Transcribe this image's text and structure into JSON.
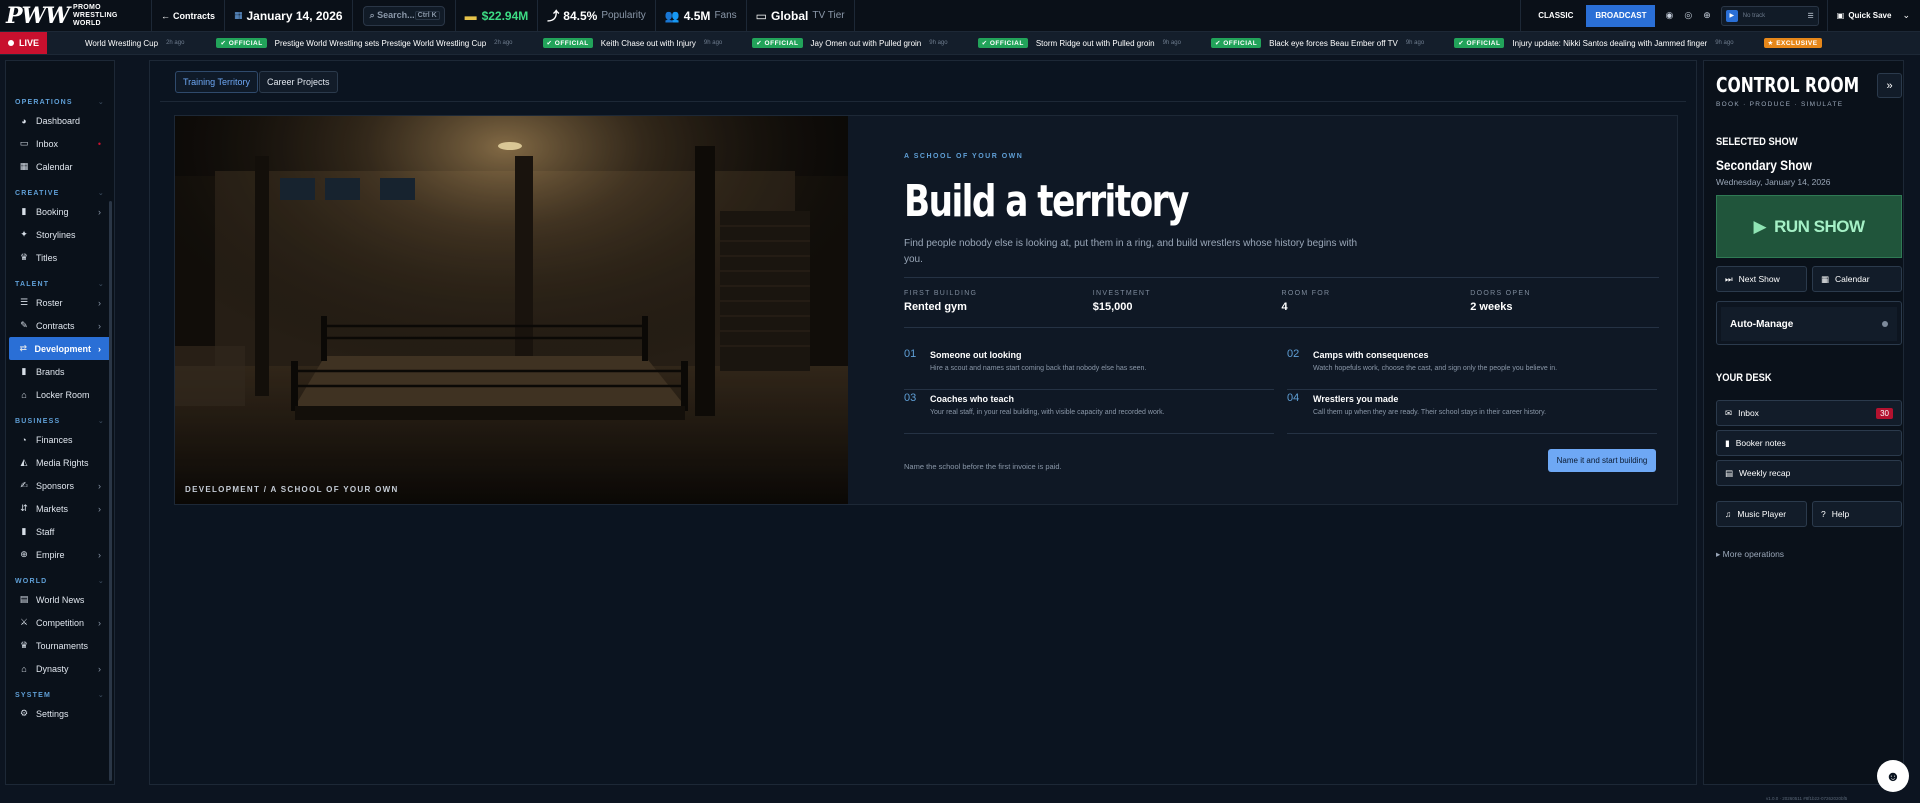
{
  "topbar": {
    "logo_main": "PWW",
    "logo_sub": "PROMO WRESTLING WORLD",
    "contracts": "Contracts",
    "date": "January 14, 2026",
    "search_placeholder": "Search...",
    "search_shortcut": "Ctrl K",
    "money": "$22.94M",
    "popularity": "84.5%",
    "popularity_label": "Popularity",
    "fans": "4.5M",
    "fans_label": "Fans",
    "tv": "Global",
    "tv_label": "TV Tier",
    "mode_classic": "CLASSIC",
    "mode_broadcast": "BROADCAST",
    "track": "No track",
    "quick_save": "Quick Save"
  },
  "ticker": {
    "live": "LIVE",
    "items": [
      {
        "badge": "",
        "text": "World Wrestling Cup",
        "ago": "2h ago"
      },
      {
        "badge": "OFFICIAL",
        "text": "Prestige World Wrestling sets Prestige World Wrestling Cup",
        "ago": "2h ago"
      },
      {
        "badge": "OFFICIAL",
        "text": "Keith Chase out with Injury",
        "ago": "9h ago"
      },
      {
        "badge": "OFFICIAL",
        "text": "Jay Omen out with Pulled groin",
        "ago": "9h ago"
      },
      {
        "badge": "OFFICIAL",
        "text": "Storm Ridge out with Pulled groin",
        "ago": "9h ago"
      },
      {
        "badge": "OFFICIAL",
        "text": "Black eye forces Beau Ember off TV",
        "ago": "9h ago"
      },
      {
        "badge": "OFFICIAL",
        "text": "Injury update: Nikki Santos dealing with Jammed finger",
        "ago": "9h ago"
      },
      {
        "badge": "EXCLUSIVE",
        "text": "",
        "ago": ""
      }
    ]
  },
  "sidebar": {
    "sections": [
      {
        "title": "OPERATIONS",
        "items": [
          {
            "label": "Dashboard",
            "icon": "dashboard-icon",
            "glyph": "◕",
            "arrow": ""
          },
          {
            "label": "Inbox",
            "icon": "inbox-icon",
            "glyph": "▭",
            "arrow": "•"
          },
          {
            "label": "Calendar",
            "icon": "calendar-icon",
            "glyph": "▦",
            "arrow": ""
          }
        ]
      },
      {
        "title": "CREATIVE",
        "items": [
          {
            "label": "Booking",
            "icon": "booking-icon",
            "glyph": "▮",
            "arrow": "›"
          },
          {
            "label": "Storylines",
            "icon": "storylines-icon",
            "glyph": "✦",
            "arrow": ""
          },
          {
            "label": "Titles",
            "icon": "trophy-icon",
            "glyph": "♛",
            "arrow": ""
          }
        ]
      },
      {
        "title": "TALENT",
        "items": [
          {
            "label": "Roster",
            "icon": "roster-icon",
            "glyph": "☰",
            "arrow": "›"
          },
          {
            "label": "Contracts",
            "icon": "contracts-icon",
            "glyph": "✎",
            "arrow": "›"
          },
          {
            "label": "Development",
            "icon": "development-icon",
            "glyph": "⇄",
            "arrow": "›",
            "active": true
          },
          {
            "label": "Brands",
            "icon": "brands-icon",
            "glyph": "▮",
            "arrow": ""
          },
          {
            "label": "Locker Room",
            "icon": "locker-room-icon",
            "glyph": "⌂",
            "arrow": ""
          }
        ]
      },
      {
        "title": "BUSINESS",
        "items": [
          {
            "label": "Finances",
            "icon": "finances-icon",
            "glyph": "◔",
            "arrow": ""
          },
          {
            "label": "Media Rights",
            "icon": "media-rights-icon",
            "glyph": "◭",
            "arrow": ""
          },
          {
            "label": "Sponsors",
            "icon": "sponsors-icon",
            "glyph": "✍",
            "arrow": "›"
          },
          {
            "label": "Markets",
            "icon": "markets-icon",
            "glyph": "⇵",
            "arrow": "›"
          },
          {
            "label": "Staff",
            "icon": "staff-icon",
            "glyph": "▮",
            "arrow": ""
          },
          {
            "label": "Empire",
            "icon": "empire-icon",
            "glyph": "⊕",
            "arrow": "›"
          }
        ]
      },
      {
        "title": "WORLD",
        "items": [
          {
            "label": "World News",
            "icon": "news-icon",
            "glyph": "▤",
            "arrow": ""
          },
          {
            "label": "Competition",
            "icon": "competition-icon",
            "glyph": "⚔",
            "arrow": "›"
          },
          {
            "label": "Tournaments",
            "icon": "tournaments-icon",
            "glyph": "♛",
            "arrow": ""
          },
          {
            "label": "Dynasty",
            "icon": "dynasty-icon",
            "glyph": "⌂",
            "arrow": "›"
          }
        ]
      },
      {
        "title": "SYSTEM",
        "items": [
          {
            "label": "Settings",
            "icon": "settings-icon",
            "glyph": "⚙",
            "arrow": ""
          }
        ]
      }
    ]
  },
  "main": {
    "tab_training": "Training Territory",
    "tab_career": "Career Projects",
    "caption": "DEVELOPMENT / A SCHOOL OF YOUR OWN",
    "eyebrow": "A SCHOOL OF YOUR OWN",
    "title": "Build a territory",
    "description": "Find people nobody else is looking at, put them in a ring, and build wrestlers whose history begins with you.",
    "stats": [
      {
        "label": "FIRST BUILDING",
        "value": "Rented gym"
      },
      {
        "label": "INVESTMENT",
        "value": "$15,000"
      },
      {
        "label": "ROOM FOR",
        "value": "4"
      },
      {
        "label": "DOORS OPEN",
        "value": "2 weeks"
      }
    ],
    "steps": [
      {
        "num": "01",
        "title": "Someone out looking",
        "desc": "Hire a scout and names start coming back that nobody else has seen."
      },
      {
        "num": "02",
        "title": "Camps with consequences",
        "desc": "Watch hopefuls work, choose the cast, and sign only the people you believe in."
      },
      {
        "num": "03",
        "title": "Coaches who teach",
        "desc": "Your real staff, in your real building, with visible capacity and recorded work."
      },
      {
        "num": "04",
        "title": "Wrestlers you made",
        "desc": "Call them up when they are ready. Their school stays in their career history."
      }
    ],
    "footnote": "Name the school before the first invoice is paid.",
    "cta": "Name it and start building"
  },
  "right": {
    "title": "CONTROL ROOM",
    "subtitle": "BOOK · PRODUCE · SIMULATE",
    "selected_label": "SELECTED SHOW",
    "show_name": "Secondary Show",
    "show_date": "Wednesday, January 14, 2026",
    "run_show": "RUN SHOW",
    "next_show": "Next Show",
    "calendar": "Calendar",
    "auto_manage": "Auto-Manage",
    "desk_label": "YOUR DESK",
    "inbox": "Inbox",
    "inbox_count": "30",
    "booker_notes": "Booker notes",
    "weekly_recap": "Weekly recap",
    "music_player": "Music Player",
    "help": "Help",
    "more_ops": "More operations"
  },
  "version": "v1.0.0 · 20260511 #8f1b22-07262020bf5",
  "colors": {
    "accent": "#2a6fd6",
    "live": "#c8102e",
    "official": "#22a35a",
    "exclusive": "#e6871a",
    "money": "#3ddc84",
    "run_show": "#20553b"
  }
}
